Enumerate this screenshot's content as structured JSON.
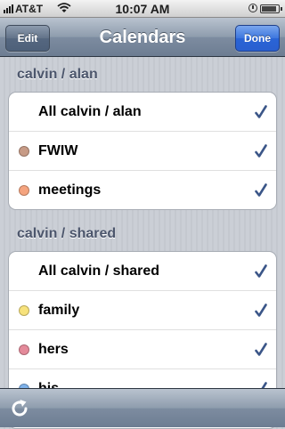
{
  "status_bar": {
    "carrier": "AT&T",
    "time": "10:07 AM",
    "icons": [
      "signal-icon",
      "wifi-icon",
      "clock-icon",
      "battery-icon"
    ]
  },
  "nav": {
    "title": "Calendars",
    "edit_label": "Edit",
    "done_label": "Done"
  },
  "groups": [
    {
      "header": "calvin / alan",
      "rows": [
        {
          "label": "All calvin / alan",
          "checked": true
        },
        {
          "label": "FWIW",
          "color": "#c79b86",
          "checked": true
        },
        {
          "label": "meetings",
          "color": "#f5a47f",
          "checked": true
        }
      ]
    },
    {
      "header": "calvin / shared",
      "rows": [
        {
          "label": "All calvin / shared",
          "checked": true
        },
        {
          "label": "family",
          "color": "#f7e27c",
          "checked": true
        },
        {
          "label": "hers",
          "color": "#e48a9a",
          "checked": true
        },
        {
          "label": "his",
          "color": "#7fb2ea",
          "checked": true
        }
      ]
    }
  ],
  "toolbar": {
    "icons": [
      "refresh-icon"
    ]
  },
  "colors": {
    "checkmark": "#3b5688",
    "section_header": "#4c566c",
    "done_button": "#2a64d6"
  }
}
